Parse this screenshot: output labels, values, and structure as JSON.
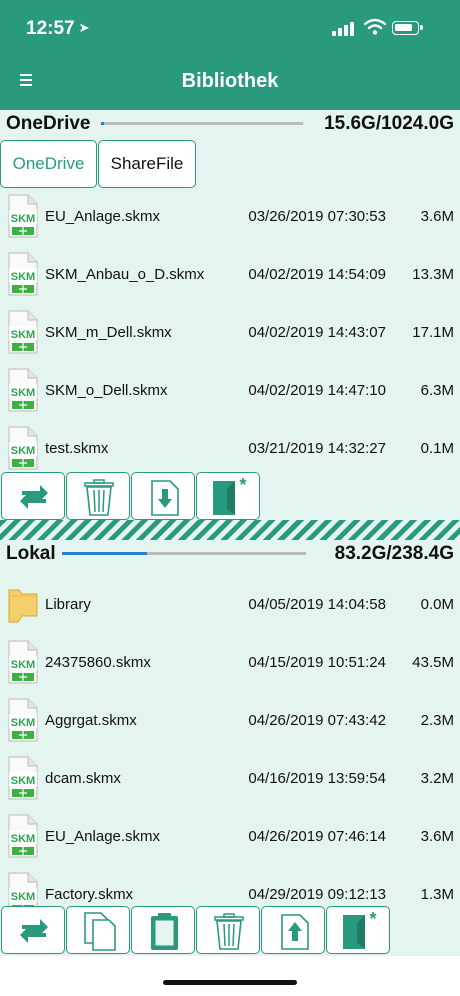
{
  "status_bar": {
    "time": "12:57"
  },
  "header": {
    "title": "Bibliothek"
  },
  "cloud": {
    "name": "OneDrive",
    "storage": "15.6G/1024.0G",
    "used_fraction": 0.015,
    "tabs": [
      {
        "label": "OneDrive",
        "active": true
      },
      {
        "label": "ShareFile",
        "active": false
      }
    ],
    "files": [
      {
        "name": "EU_Anlage.skmx",
        "date": "03/26/2019 07:30:53",
        "size": "3.6M",
        "type": "skm"
      },
      {
        "name": "SKM_Anbau_o_D.skmx",
        "date": "04/02/2019 14:54:09",
        "size": "13.3M",
        "type": "skm"
      },
      {
        "name": "SKM_m_Dell.skmx",
        "date": "04/02/2019 14:43:07",
        "size": "17.1M",
        "type": "skm"
      },
      {
        "name": "SKM_o_Dell.skmx",
        "date": "04/02/2019 14:47:10",
        "size": "6.3M",
        "type": "skm"
      },
      {
        "name": "test.skmx",
        "date": "03/21/2019 14:32:27",
        "size": "0.1M",
        "type": "skm"
      }
    ]
  },
  "local": {
    "name": "Lokal",
    "storage": "83.2G/238.4G",
    "used_fraction": 0.349,
    "files": [
      {
        "name": "Library",
        "date": "04/05/2019 14:04:58",
        "size": "0.0M",
        "type": "folder"
      },
      {
        "name": "24375860.skmx",
        "date": "04/15/2019 10:51:24",
        "size": "43.5M",
        "type": "skm"
      },
      {
        "name": "Aggrgat.skmx",
        "date": "04/26/2019 07:43:42",
        "size": "2.3M",
        "type": "skm"
      },
      {
        "name": "dcam.skmx",
        "date": "04/16/2019 13:59:54",
        "size": "3.2M",
        "type": "skm"
      },
      {
        "name": "EU_Anlage.skmx",
        "date": "04/26/2019 07:46:14",
        "size": "3.6M",
        "type": "skm"
      },
      {
        "name": "Factory.skmx",
        "date": "04/29/2019 09:12:13",
        "size": "1.3M",
        "type": "skm"
      }
    ]
  },
  "file_icon_label": "SKM",
  "toolbar_top": [
    "sync-icon",
    "trash-icon",
    "download-icon",
    "new-book-icon"
  ],
  "toolbar_bottom": [
    "sync-icon",
    "copy-icon",
    "paste-icon",
    "trash-icon",
    "upload-icon",
    "new-book-icon"
  ],
  "colors": {
    "accent": "#2a9a7e",
    "pane_bg": "#e4f4ef",
    "storage_used": "#2a7fd0"
  }
}
